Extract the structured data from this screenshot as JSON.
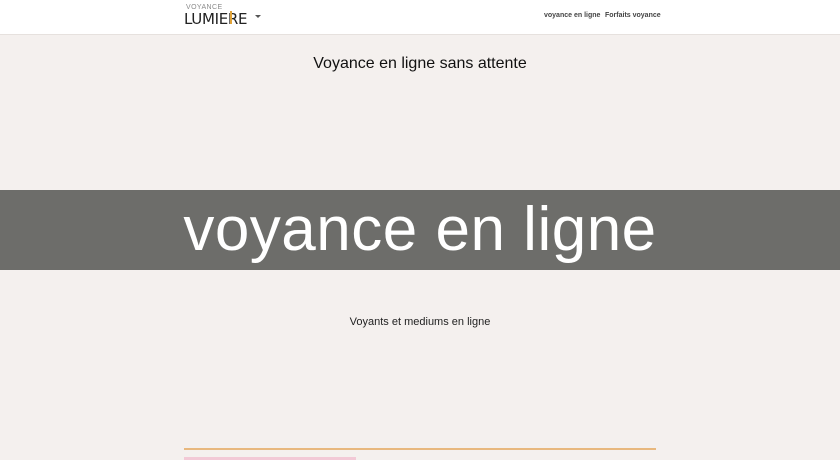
{
  "header": {
    "logo": {
      "small_text": "VOYANCE",
      "big_text": "LUMIERE"
    },
    "nav": [
      {
        "label": "voyance en ligne"
      },
      {
        "label": "Forfaits voyance"
      }
    ]
  },
  "main": {
    "title": "Voyance en ligne sans attente",
    "banner_text": "voyance en ligne",
    "subtitle": "Voyants et mediums en ligne"
  },
  "colors": {
    "background": "#f4f0ee",
    "banner": "#6d6d6a",
    "accent": "#e2a43a"
  }
}
